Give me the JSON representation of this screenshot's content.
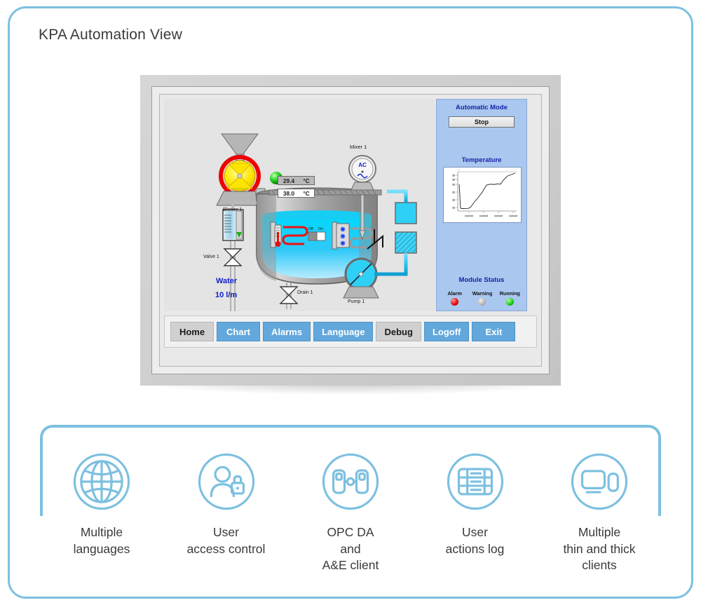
{
  "page": {
    "title": "KPA Automation View",
    "accent_blue": "#7cc0e0",
    "panel_blue": "#a9c7ef",
    "button_blue": "#63a8dc"
  },
  "hmi": {
    "side_panel": {
      "mode_title": "Automatic Mode",
      "mode_button_label": "Stop",
      "trend_title": "Temperature",
      "status_title": "Module Status",
      "leds": [
        {
          "label": "Alarm",
          "state": "red",
          "color": "#e60000"
        },
        {
          "label": "Warning",
          "state": "gray",
          "color": "#b5b5b5"
        },
        {
          "label": "Running",
          "state": "green",
          "color": "#18cc18"
        }
      ]
    },
    "readouts": [
      {
        "name": "process-temperature",
        "value": "29.4",
        "unit": "°C",
        "style": "gray"
      },
      {
        "name": "setpoint-temperature",
        "value": "38.0",
        "unit": "°C",
        "style": "white"
      }
    ],
    "equipment": {
      "blower_label": "Blower 1",
      "mixer_label": "Mixer 1",
      "mixer_symbol": "AC",
      "valve_label": "Valve 1",
      "drain_label": "Drain 1",
      "pump_label": "Pump 1",
      "water_label": "Water",
      "water_flow": "10 l/m",
      "toggle_off": "Off",
      "toggle_on": "On"
    },
    "buttons": [
      {
        "label": "Home",
        "style": "gray"
      },
      {
        "label": "Chart",
        "style": "blue"
      },
      {
        "label": "Alarms",
        "style": "blue"
      },
      {
        "label": "Language",
        "style": "blue"
      },
      {
        "label": "Debug",
        "style": "gray"
      },
      {
        "label": "Logoff",
        "style": "blue"
      },
      {
        "label": "Exit",
        "style": "blue"
      }
    ]
  },
  "chart_data": {
    "type": "line",
    "title": "Temperature",
    "xlabel": "",
    "ylabel": "",
    "ylim": [
      17,
      29.5
    ],
    "yticks": [
      18,
      20,
      22,
      24,
      26,
      28
    ],
    "xticks": [
      "14:20:00",
      "14:20:15",
      "14:20:30",
      "14:20:45"
    ],
    "grid": false,
    "legend": "none",
    "series": [
      {
        "name": "Temperature",
        "x": [
          0,
          1,
          2,
          3,
          5,
          8,
          12,
          16,
          20,
          26,
          32,
          38,
          42,
          44,
          47,
          50,
          52,
          54,
          57,
          60
        ],
        "values": [
          24.4,
          21.0,
          19.3,
          18.1,
          18.0,
          18.0,
          18.1,
          18.3,
          19.3,
          21.0,
          22.5,
          24.1,
          24.3,
          24.2,
          24.2,
          24.4,
          24.3,
          25.6,
          27.4,
          29.0
        ]
      }
    ]
  },
  "features": [
    {
      "icon": "globe-icon",
      "caption": "Multiple\nlanguages"
    },
    {
      "icon": "user-lock-icon",
      "caption": "User\naccess control"
    },
    {
      "icon": "opc-link-icon",
      "caption": "OPC DA\nand\nA&E client"
    },
    {
      "icon": "log-table-icon",
      "caption": "User\nactions log"
    },
    {
      "icon": "clients-icon",
      "caption": "Multiple\nthin and thick\nclients"
    }
  ]
}
